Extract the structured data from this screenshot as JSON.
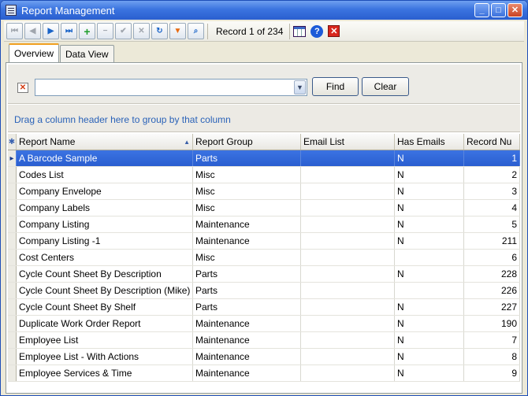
{
  "window": {
    "title": "Report Management"
  },
  "toolbar": {
    "record_label": "Record 1 of 234",
    "buttons": [
      "first-icon",
      "prev-icon",
      "next-icon",
      "last-icon",
      "add-icon",
      "delete-icon",
      "post-icon",
      "cancel-icon",
      "refresh-icon",
      "filter-icon",
      "search-icon",
      "grid-icon",
      "help-icon",
      "exit-icon"
    ]
  },
  "tabs": [
    {
      "label": "Overview"
    },
    {
      "label": "Data View"
    }
  ],
  "search": {
    "value": "",
    "find_label": "Find",
    "clear_label": "Clear"
  },
  "group_hint": "Drag a column header here to group by that column",
  "grid": {
    "columns": [
      "Report Name",
      "Report Group",
      "Email List",
      "Has Emails",
      "Record Nu"
    ],
    "rows": [
      [
        "A Barcode Sample",
        "Parts",
        "",
        "N",
        "1"
      ],
      [
        "Codes List",
        "Misc",
        "",
        "N",
        "2"
      ],
      [
        "Company Envelope",
        "Misc",
        "",
        "N",
        "3"
      ],
      [
        "Company Labels",
        "Misc",
        "",
        "N",
        "4"
      ],
      [
        "Company Listing",
        "Maintenance",
        "",
        "N",
        "5"
      ],
      [
        "Company Listing -1",
        "Maintenance",
        "",
        "N",
        "211"
      ],
      [
        "Cost Centers",
        "Misc",
        "",
        "",
        "6"
      ],
      [
        "Cycle Count Sheet By Description",
        "Parts",
        "",
        "N",
        "228"
      ],
      [
        "Cycle Count Sheet By Description (Mike)",
        "Parts",
        "",
        "",
        "226"
      ],
      [
        "Cycle Count Sheet By Shelf",
        "Parts",
        "",
        "N",
        "227"
      ],
      [
        "Duplicate Work Order Report",
        "Maintenance",
        "",
        "N",
        "190"
      ],
      [
        "Employee List",
        "Maintenance",
        "",
        "N",
        "7"
      ],
      [
        "Employee List - With Actions",
        "Maintenance",
        "",
        "N",
        "8"
      ],
      [
        "Employee Services & Time",
        "Maintenance",
        "",
        "N",
        "9"
      ]
    ]
  },
  "colors": {
    "title_bar": "#2a5fcf",
    "selection": "#3b73e2",
    "group_hint": "#2a62b8"
  }
}
